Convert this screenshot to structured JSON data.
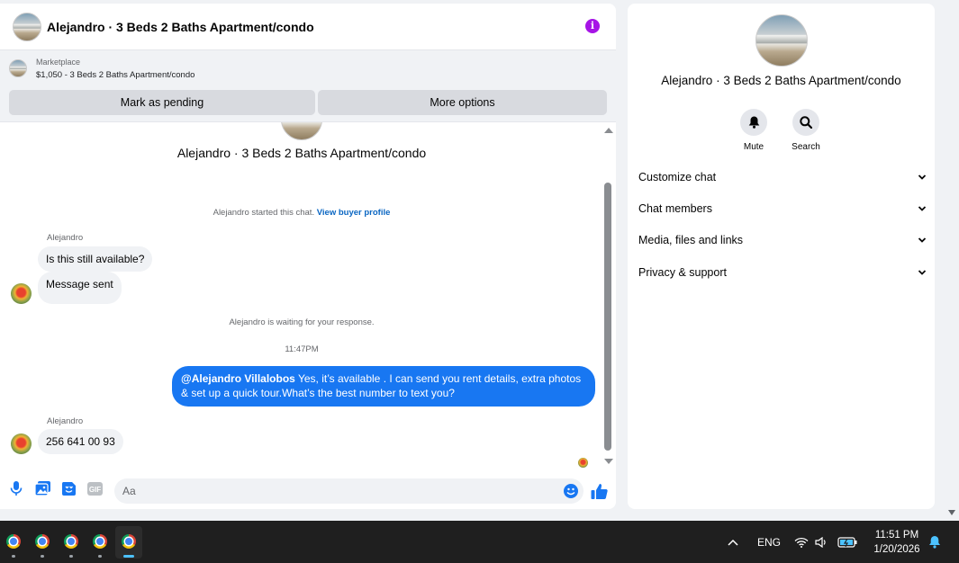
{
  "header": {
    "title": "Alejandro · 3 Beds 2 Baths Apartment/condo"
  },
  "listing": {
    "label": "Marketplace",
    "price_title": "$1,050 - 3 Beds 2 Baths Apartment/condo",
    "mark_pending_label": "Mark as pending",
    "more_options_label": "More options"
  },
  "conversation": {
    "title": "Alejandro · 3 Beds 2 Baths Apartment/condo",
    "started_text": "Alejandro started this chat.",
    "view_profile_link": "View buyer profile",
    "waiting_text": "Alejandro is waiting for your response.",
    "timestamp": "11:47PM",
    "messages": [
      {
        "sender": "Alejandro",
        "text": "Is this still available?"
      },
      {
        "text": "Message sent"
      },
      {
        "mention": "@Alejandro Villalobos",
        "text": " Yes, it’s available .  I can send you rent details, extra photos & set up a quick tour.What’s the best number to text you?"
      },
      {
        "sender": "Alejandro",
        "text": "256 641 00 93"
      }
    ]
  },
  "composer": {
    "placeholder": "Aa"
  },
  "details": {
    "title": "Alejandro · 3 Beds 2 Baths Apartment/condo",
    "actions": [
      {
        "label": "Mute",
        "icon": "bell-icon"
      },
      {
        "label": "Search",
        "icon": "search-icon"
      }
    ],
    "sections": [
      {
        "label": "Customize chat"
      },
      {
        "label": "Chat members"
      },
      {
        "label": "Media, files and links"
      },
      {
        "label": "Privacy & support"
      }
    ]
  },
  "taskbar": {
    "apps": [
      "chrome-icon",
      "chrome-icon",
      "chrome-icon",
      "chrome-icon",
      "chrome-icon"
    ],
    "language": "ENG",
    "time": "11:51 PM",
    "date": "1/20/2026"
  },
  "colors": {
    "accent": "#1877f2",
    "info": "#a614e6",
    "surface": "#f0f2f5",
    "taskbar": "#1f1f1f"
  }
}
